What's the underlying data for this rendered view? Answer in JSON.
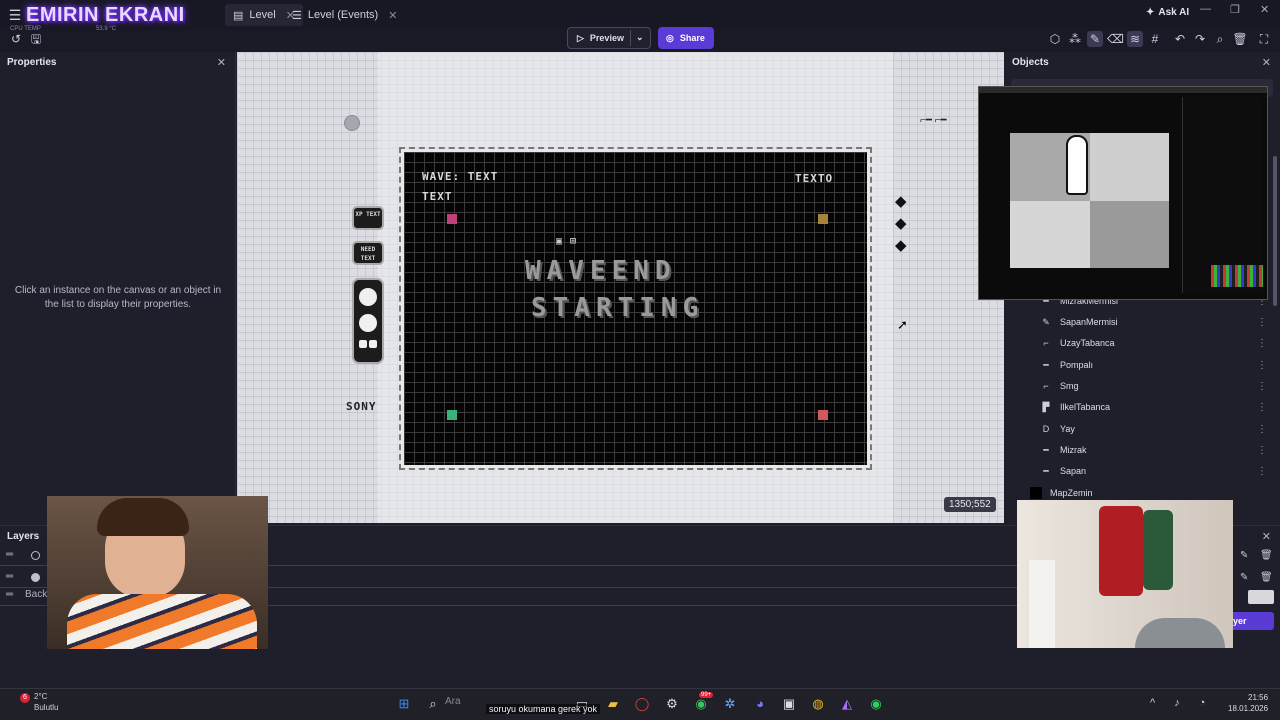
{
  "overlay": {
    "title": "EMIRIN EKRANI",
    "info1": "CPU TEMP",
    "info2": "53.9 °C"
  },
  "titlebar": {
    "tabs": [
      {
        "label": "Level",
        "active": true
      },
      {
        "label": "Level (Events)",
        "active": false
      }
    ],
    "ask_ai": "Ask AI"
  },
  "toolbar": {
    "preview_label": "Preview",
    "share_label": "Share",
    "accent": "#5b3bd6"
  },
  "properties": {
    "title": "Properties",
    "hint": "Click an instance on the canvas or an object in the list to display their properties."
  },
  "canvas": {
    "wave_label": "WAVE: TEXT",
    "text_label": "TEXT",
    "texto_label": "TEXTO",
    "big_line1": "WAVEEND",
    "big_line2": "STARTING",
    "xp_badge": "XP TEXT",
    "need_badge": "NEED TEXT",
    "sony": "SONY",
    "coord": "1350;552"
  },
  "objects": {
    "title": "Objects",
    "items": [
      {
        "icon": "sword-icon",
        "glyph": "━",
        "label": "MizrakMermisi"
      },
      {
        "icon": "sling-icon",
        "glyph": "✎",
        "label": "SapanMermisi"
      },
      {
        "icon": "space-gun-icon",
        "glyph": "⌐",
        "label": "UzayTabanca"
      },
      {
        "icon": "shotgun-icon",
        "glyph": "━",
        "label": "Pompalı"
      },
      {
        "icon": "smg-icon",
        "glyph": "⌐",
        "label": "Smg"
      },
      {
        "icon": "pistol-icon",
        "glyph": "▛",
        "label": "IlkelTabanca"
      },
      {
        "icon": "bow-icon",
        "glyph": "D",
        "label": "Yay"
      },
      {
        "icon": "spear-icon",
        "glyph": "━",
        "label": "Mizrak"
      },
      {
        "icon": "slingshot-icon",
        "glyph": "━",
        "label": "Sapan"
      },
      {
        "icon": "tile-icon",
        "glyph": "■",
        "label": "MapZemin"
      }
    ]
  },
  "layers": {
    "title": "Layers",
    "rows": [
      {
        "name": ""
      },
      {
        "name": ""
      },
      {
        "name": "Back"
      }
    ],
    "player_button": "yer"
  },
  "taskbar": {
    "weather_badge": "6",
    "weather_temp": "2°C",
    "weather_desc": "Bulutlu",
    "search_placeholder": "Ara",
    "subtitle": "soruyu okumana gerek yok",
    "time": "21:56",
    "date": "18.01.2026",
    "notif_badge": "99+"
  }
}
